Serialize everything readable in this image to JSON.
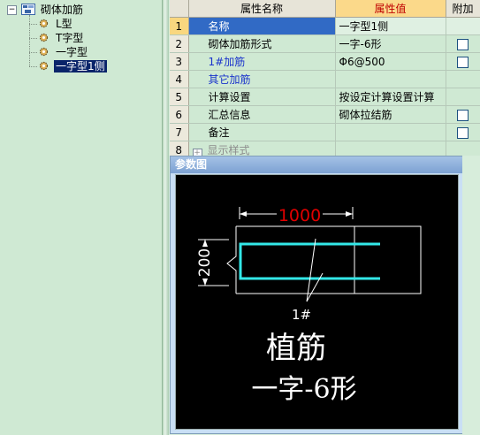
{
  "tree": {
    "root_label": "砌体加筋",
    "items": [
      {
        "label": "L型"
      },
      {
        "label": "T字型"
      },
      {
        "label": "一字型"
      },
      {
        "label": "一字型1侧",
        "selected": true
      }
    ]
  },
  "grid": {
    "headers": {
      "name": "属性名称",
      "value": "属性值",
      "extra": "附加"
    },
    "rows": [
      {
        "num": "1",
        "name": "名称",
        "value": "一字型1侧",
        "checkbox": false,
        "active": true
      },
      {
        "num": "2",
        "name": "砌体加筋形式",
        "value": "一字-6形",
        "checkbox": true
      },
      {
        "num": "3",
        "name": "1#加筋",
        "value": "Φ6@500",
        "checkbox": true,
        "blue": true
      },
      {
        "num": "4",
        "name": "其它加筋",
        "value": "",
        "checkbox": false,
        "blue": true
      },
      {
        "num": "5",
        "name": "计算设置",
        "value": "按设定计算设置计算",
        "checkbox": false
      },
      {
        "num": "6",
        "name": "汇总信息",
        "value": "砌体拉结筋",
        "checkbox": true
      },
      {
        "num": "7",
        "name": "备注",
        "value": "",
        "checkbox": true
      },
      {
        "num": "8",
        "name": "显示样式",
        "value": "",
        "checkbox": false,
        "expandable": true,
        "gray": true
      }
    ]
  },
  "reference": {
    "title": "参数图",
    "dim_length": "1000",
    "dim_width": "200",
    "bar_label": "1#",
    "caption_line1": "植筋",
    "caption_line2": "一字-6形"
  },
  "colors": {
    "dimension_red": "#e00000",
    "rebar_cyan": "#33e8e8",
    "selection_blue": "#0a246a"
  }
}
